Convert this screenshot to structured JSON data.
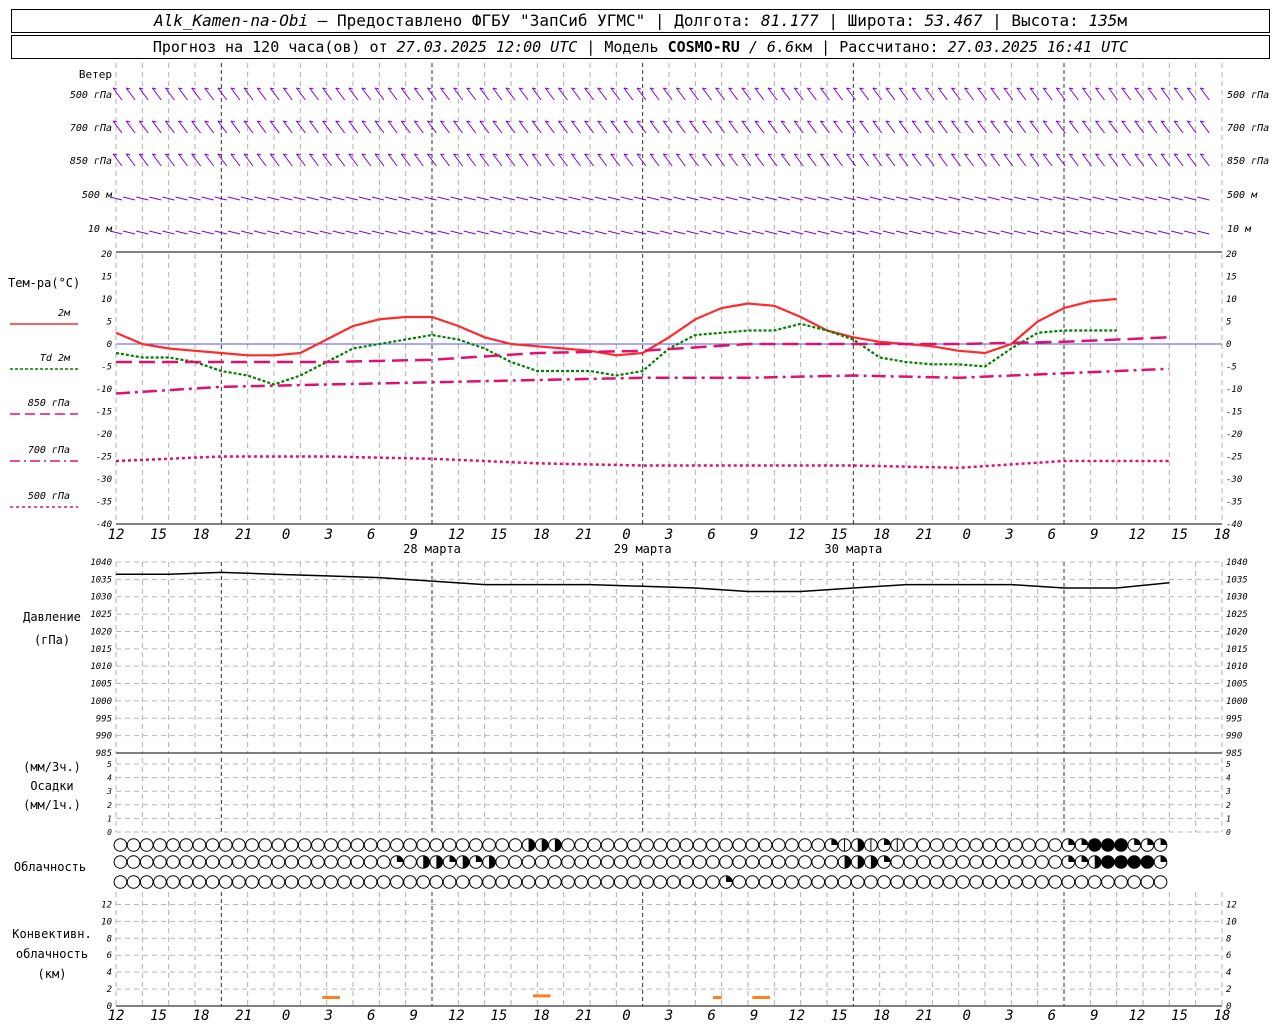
{
  "header": {
    "station": "Alk_Kamen-na-Obi",
    "provider": "— Предоставлено ФГБУ \"ЗапСиб УГМС\"",
    "lon_label": "Долгота:",
    "lon": "81.177",
    "lat_label": "Широта:",
    "lat": "53.467",
    "alt_label": "Высота:",
    "alt": "135",
    "alt_unit": "м",
    "forecast_label": "Прогноз на 120 часа(ов) от",
    "forecast_start": "27.03.2025 12:00 UTC",
    "model_label": "Модель",
    "model": "COSMO-RU",
    "model_res": "/ 6.6",
    "model_res_unit": "км",
    "calc_label": "Рассчитано:",
    "calc_time": "27.03.2025 16:41 UTC"
  },
  "wind_panel": {
    "title": "Ветер",
    "levels": [
      "500 гПа",
      "700 гПа",
      "850 гПа",
      "500 м",
      "10 м"
    ],
    "color": "#7a00e0"
  },
  "temp_panel": {
    "title": "Тем-ра(°C)",
    "yticks": [
      20,
      15,
      10,
      5,
      0,
      -5,
      -10,
      -15,
      -20,
      -25,
      -30,
      -35,
      -40
    ],
    "legend": [
      {
        "label": "2м",
        "color": "#ff2a2a",
        "style": "solid"
      },
      {
        "label": "Td  2м",
        "color": "#008000",
        "style": "dotted"
      },
      {
        "label": "850 гПа",
        "color": "#e0106e",
        "style": "dash"
      },
      {
        "label": "700 гПа",
        "color": "#e0106e",
        "style": "dashdot"
      },
      {
        "label": "500 гПа",
        "color": "#e0106e",
        "style": "dot"
      }
    ]
  },
  "pressure_panel": {
    "title": "Давление",
    "unit": "(гПа)",
    "yticks": [
      1040,
      1035,
      1030,
      1025,
      1020,
      1015,
      1010,
      1005,
      1000,
      995,
      990,
      985
    ]
  },
  "precip_panel": {
    "unit3": "(мм/3ч.)",
    "title": "Осадки",
    "unit1": "(мм/1ч.)",
    "yticks": [
      5,
      4,
      3,
      2,
      1,
      0
    ]
  },
  "cloud_panel": {
    "title": "Облачность",
    "rows": [
      "0000000000000000000000000000000000000000000000000033330000000000000000000000000000000002313312210000000000000000000002234444422224",
      "0000000000000000000000000000000002013232332230000000000000000000000000000000000000000003313220200000000000000000002223444444423",
      "00000000000000000000000000000000000000000000000000000000000000000000002000000000000000000000000000000000000000000000000000"
    ]
  },
  "conv_panel": {
    "title1": "Конвективн.",
    "title2": "облачность",
    "unit": "(км)",
    "yticks": [
      12,
      10,
      8,
      6,
      4,
      2,
      0
    ],
    "color": "#ff7f1e"
  },
  "time_axis": {
    "hour_labels": [
      "12",
      "15",
      "18",
      "21",
      "0",
      "3",
      "6",
      "9",
      "12",
      "15",
      "18",
      "21",
      "0",
      "3",
      "6",
      "9",
      "12",
      "15",
      "18",
      "21",
      "0",
      "3",
      "6",
      "9",
      "12",
      "15",
      "18"
    ],
    "day_labels": [
      "28 марта",
      "29 марта",
      "30 марта"
    ]
  },
  "chart_data": {
    "type": "line",
    "x_unit": "часы от 27.03.2025 12:00 UTC",
    "x_step_hours": 3,
    "temperature": {
      "ylim": [
        -40,
        20
      ],
      "series": [
        {
          "name": "2м",
          "x": [
            0,
            3,
            6,
            9,
            12,
            15,
            18,
            21,
            24,
            27,
            30,
            33,
            36,
            39,
            42,
            45,
            48,
            51,
            54,
            57,
            60,
            63,
            66,
            69,
            72,
            75,
            78,
            81,
            84,
            87,
            90,
            93,
            96,
            99,
            102,
            105,
            108,
            111,
            114
          ],
          "values": [
            2.5,
            0,
            -1,
            -1.5,
            -2,
            -2.5,
            -2.5,
            -2,
            1,
            4,
            5.5,
            6,
            6,
            4,
            1.5,
            0,
            -0.5,
            -1,
            -1.5,
            -2.5,
            -2,
            1.5,
            5.5,
            8,
            9,
            8.5,
            6,
            3,
            1.5,
            0.5,
            0,
            -0.5,
            -1.5,
            -2,
            0,
            5,
            8,
            9.5,
            10,
            9,
            7,
            5,
            3.5,
            2
          ]
        },
        {
          "name": "Td 2м",
          "x": [
            0,
            3,
            6,
            9,
            12,
            15,
            18,
            21,
            24,
            27,
            30,
            33,
            36,
            39,
            42,
            45,
            48,
            51,
            54,
            57,
            60,
            63,
            66,
            69,
            72,
            75,
            78,
            81,
            84,
            87,
            90,
            93,
            96,
            99,
            102,
            105,
            108,
            111,
            114
          ],
          "values": [
            -2,
            -3,
            -3,
            -4,
            -6,
            -7,
            -9,
            -7,
            -4,
            -1,
            0,
            1,
            2,
            1,
            -1,
            -4,
            -6,
            -6,
            -6,
            -7,
            -6,
            -1,
            2,
            2.5,
            3,
            3,
            4.5,
            3,
            1,
            -3,
            -4,
            -4.5,
            -4.5,
            -5,
            -1,
            2.5,
            3,
            3,
            3,
            5.5,
            4.5,
            3,
            2
          ]
        },
        {
          "name": "850 гПа",
          "x": [
            0,
            12,
            24,
            36,
            48,
            60,
            72,
            84,
            96,
            108,
            120
          ],
          "values": [
            -4,
            -4,
            -4,
            -3.5,
            -2,
            -1.5,
            0,
            0,
            0,
            0.5,
            1.5
          ]
        },
        {
          "name": "700 гПа",
          "x": [
            0,
            12,
            24,
            36,
            48,
            60,
            72,
            84,
            96,
            108,
            120
          ],
          "values": [
            -11,
            -9.5,
            -9,
            -8.5,
            -8,
            -7.5,
            -7.5,
            -7,
            -7.5,
            -6.5,
            -5.5
          ]
        },
        {
          "name": "500 гПа",
          "x": [
            0,
            12,
            24,
            36,
            48,
            60,
            72,
            84,
            96,
            108,
            120
          ],
          "values": [
            -26,
            -25,
            -25,
            -25.5,
            -26.5,
            -27,
            -27,
            -27,
            -27.5,
            -26,
            -26
          ]
        }
      ]
    },
    "pressure": {
      "ylim": [
        985,
        1040
      ],
      "x": [
        0,
        6,
        12,
        18,
        24,
        30,
        36,
        42,
        48,
        54,
        60,
        66,
        72,
        78,
        84,
        90,
        96,
        102,
        108,
        114,
        120
      ],
      "values": [
        1036.5,
        1036.5,
        1037,
        1036.5,
        1036,
        1035.5,
        1034.5,
        1033.5,
        1033.5,
        1033.5,
        1033,
        1032.5,
        1031.5,
        1031.5,
        1032.5,
        1033.5,
        1033.5,
        1033.5,
        1032.5,
        1032.5,
        1034
      ]
    },
    "precipitation": {
      "ylim": [
        0,
        5
      ],
      "values": []
    },
    "convective_cloud": {
      "ylim": [
        0,
        13
      ],
      "segments": [
        {
          "x_start": 23.5,
          "x_end": 25.5,
          "value": 1
        },
        {
          "x_start": 47.5,
          "x_end": 49.5,
          "value": 1.2
        },
        {
          "x_start": 68,
          "x_end": 69,
          "value": 1
        },
        {
          "x_start": 72.5,
          "x_end": 74.5,
          "value": 1
        }
      ]
    }
  }
}
